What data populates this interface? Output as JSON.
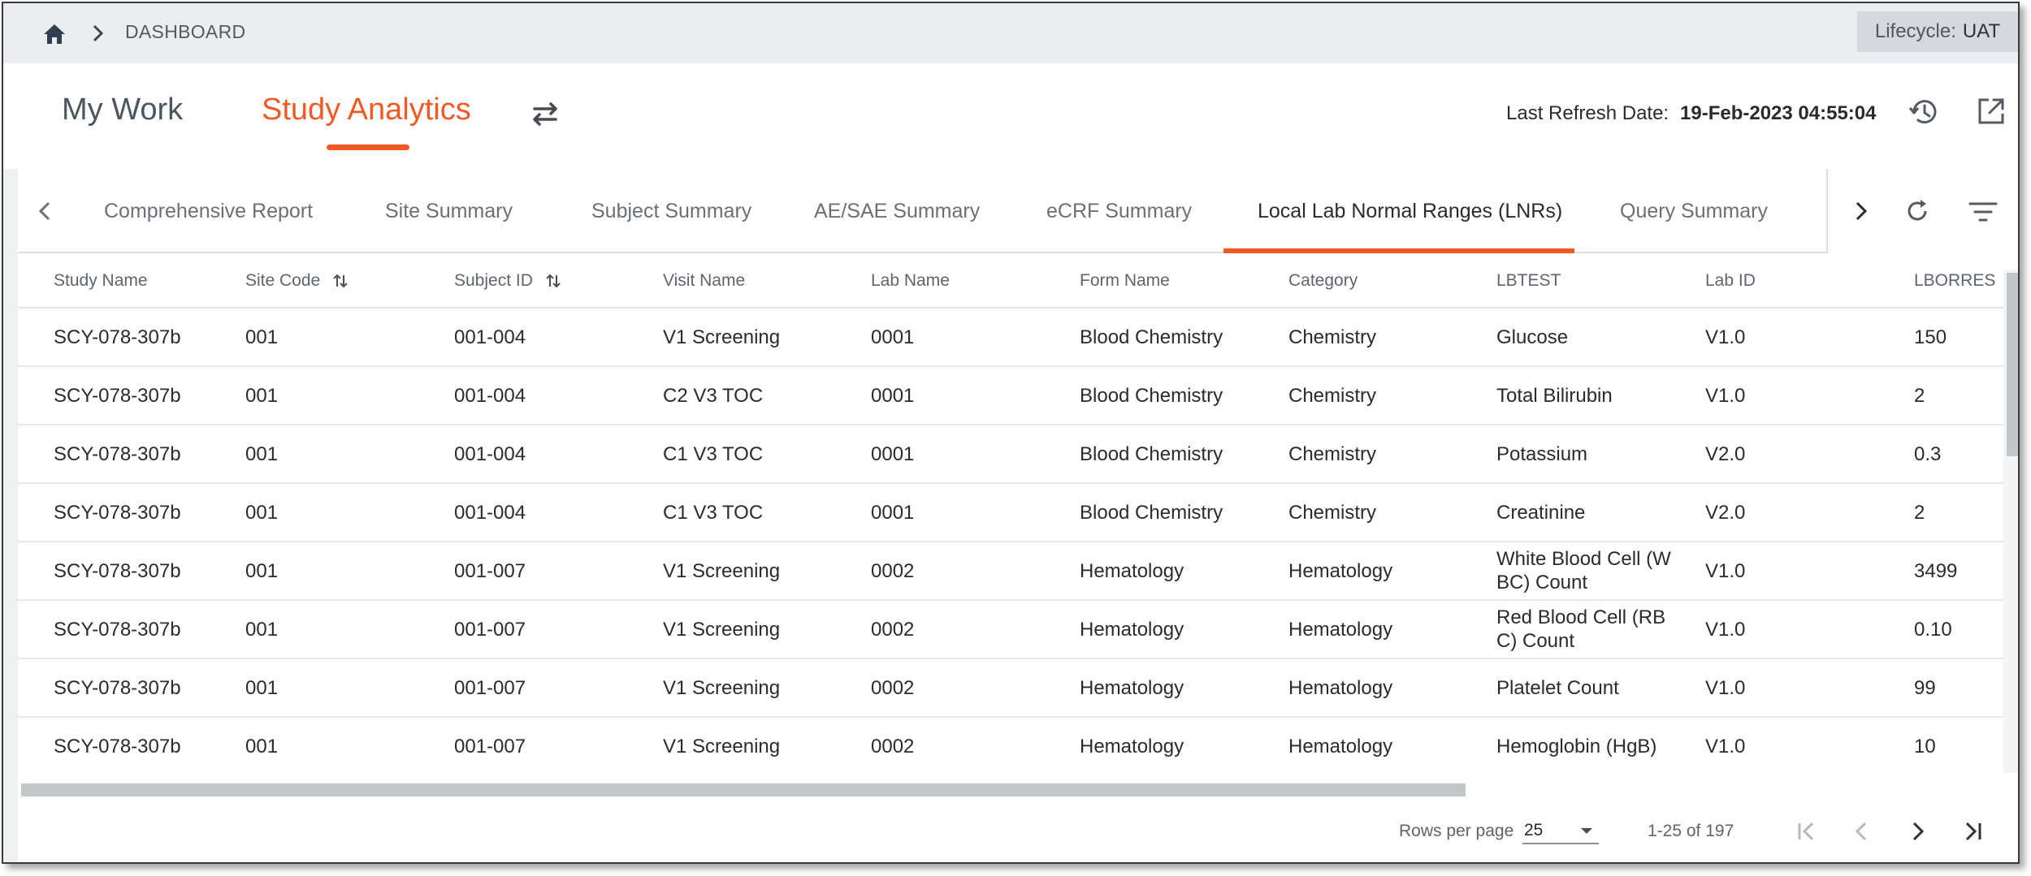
{
  "breadcrumb": {
    "current": "DASHBOARD"
  },
  "lifecycle": {
    "label": "Lifecycle:",
    "value": "UAT"
  },
  "header": {
    "tabs": [
      {
        "label": "My Work"
      },
      {
        "label": "Study Analytics"
      }
    ],
    "last_refresh_label": "Last Refresh Date:",
    "last_refresh_value": "19-Feb-2023 04:55:04"
  },
  "report_tabs": [
    {
      "label": "Comprehensive Report"
    },
    {
      "label": "Site Summary"
    },
    {
      "label": "Subject Summary"
    },
    {
      "label": "AE/SAE Summary"
    },
    {
      "label": "eCRF Summary"
    },
    {
      "label": "Local Lab Normal Ranges (LNRs)",
      "active": true
    },
    {
      "label": "Query Summary"
    }
  ],
  "table": {
    "columns": [
      "Study Name",
      "Site Code",
      "Subject ID",
      "Visit Name",
      "Lab Name",
      "Form Name",
      "Category",
      "LBTEST",
      "Lab ID",
      "LBORRES"
    ],
    "rows": [
      [
        "SCY-078-307b",
        "001",
        "001-004",
        "V1 Screening",
        "0001",
        "Blood Chemistry",
        "Chemistry",
        "Glucose",
        "V1.0",
        "150"
      ],
      [
        "SCY-078-307b",
        "001",
        "001-004",
        "C2 V3 TOC",
        "0001",
        "Blood Chemistry",
        "Chemistry",
        "Total Bilirubin",
        "V1.0",
        "2"
      ],
      [
        "SCY-078-307b",
        "001",
        "001-004",
        "C1 V3 TOC",
        "0001",
        "Blood Chemistry",
        "Chemistry",
        "Potassium",
        "V2.0",
        "0.3"
      ],
      [
        "SCY-078-307b",
        "001",
        "001-004",
        "C1 V3 TOC",
        "0001",
        "Blood Chemistry",
        "Chemistry",
        "Creatinine",
        "V2.0",
        "2"
      ],
      [
        "SCY-078-307b",
        "001",
        "001-007",
        "V1 Screening",
        "0002",
        "Hematology",
        "Hematology",
        "White Blood Cell (W BC) Count",
        "V1.0",
        "3499"
      ],
      [
        "SCY-078-307b",
        "001",
        "001-007",
        "V1 Screening",
        "0002",
        "Hematology",
        "Hematology",
        "Red Blood Cell (RB C) Count",
        "V1.0",
        "0.10"
      ],
      [
        "SCY-078-307b",
        "001",
        "001-007",
        "V1 Screening",
        "0002",
        "Hematology",
        "Hematology",
        "Platelet Count",
        "V1.0",
        "99"
      ],
      [
        "SCY-078-307b",
        "001",
        "001-007",
        "V1 Screening",
        "0002",
        "Hematology",
        "Hematology",
        "Hemoglobin (HgB)",
        "V1.0",
        "10"
      ]
    ]
  },
  "pagination": {
    "rows_per_page_label": "Rows per page",
    "rows_per_page_value": "25",
    "range_text": "1-25 of 197"
  },
  "colors": {
    "accent": "#f15a24",
    "topbar": "#ebedf0",
    "lifecycle_bg": "#d5d9de"
  },
  "icons": [
    "home-icon",
    "chevron-right-icon",
    "swap-icon",
    "history-icon",
    "open-external-icon",
    "chevron-left-icon",
    "reload-icon",
    "filter-icon",
    "sort-icon",
    "first-page-icon",
    "prev-page-icon",
    "next-page-icon",
    "last-page-icon"
  ]
}
